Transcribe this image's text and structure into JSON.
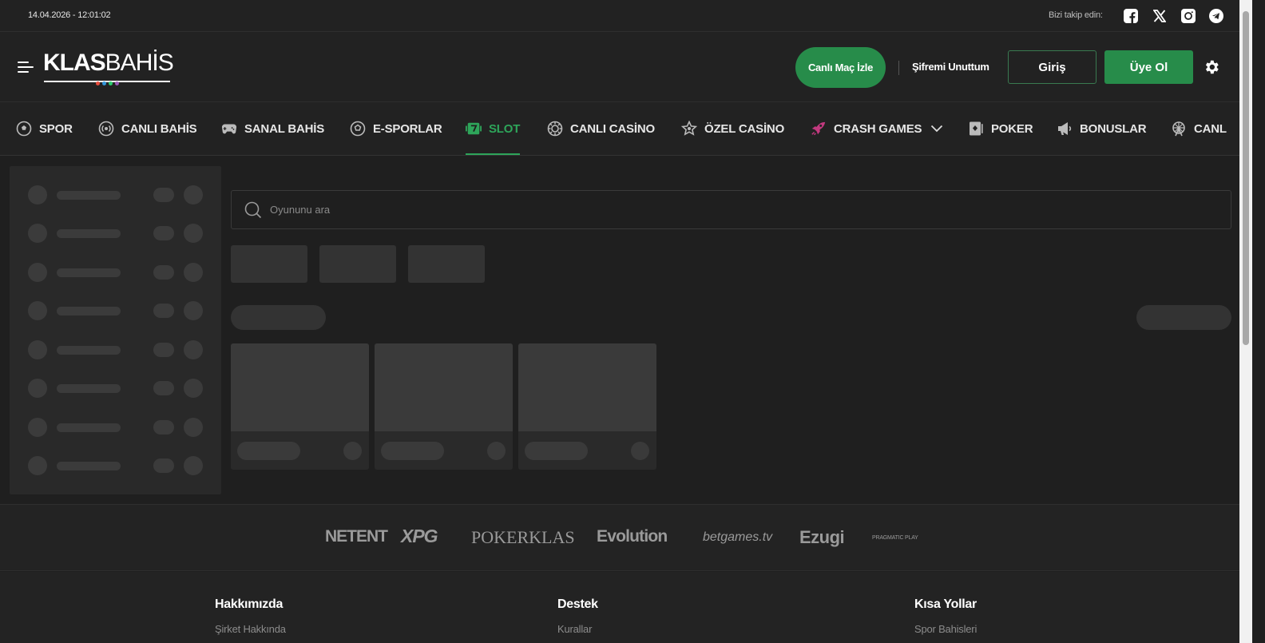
{
  "topbar": {
    "datetime": "14.04.2026 - 12:01:02",
    "follow_label": "Bizi takip edin:",
    "social": [
      "facebook-icon",
      "x-icon",
      "instagram-icon",
      "telegram-icon"
    ]
  },
  "header": {
    "logo": {
      "bold": "KLAS",
      "light": "BAHİS",
      "dot_colors": [
        "#e74c3c",
        "#3498db",
        "#2ecc71",
        "#9b59b6"
      ]
    },
    "live_button": "Canlı Maç İzle",
    "forgot_password": "Şifremi Unuttum",
    "login": "Giriş",
    "register": "Üye Ol"
  },
  "nav": {
    "items": [
      {
        "label": "SPOR",
        "icon": "soccer-ball-icon"
      },
      {
        "label": "CANLI BAHİS",
        "icon": "live-broadcast-icon"
      },
      {
        "label": "SANAL BAHİS",
        "icon": "gamepad-icon"
      },
      {
        "label": "E-SPORLAR",
        "icon": "esports-icon"
      },
      {
        "label": "SLOT",
        "icon": "slot-seven-icon",
        "active": true
      },
      {
        "label": "CANLI CASİNO",
        "icon": "casino-chip-icon"
      },
      {
        "label": "ÖZEL CASİNO",
        "icon": "star-icon"
      },
      {
        "label": "CRASH GAMES",
        "icon": "rocket-icon"
      },
      {
        "label": "POKER",
        "icon": "playing-card-icon"
      },
      {
        "label": "BONUSLAR",
        "icon": "megaphone-icon"
      },
      {
        "label": "CANL",
        "icon": "ferris-wheel-icon"
      }
    ],
    "accent": "#2ea55a"
  },
  "search": {
    "placeholder": "Oyununu ara"
  },
  "providers": [
    "NETENT",
    "XPG",
    "POKERKLAS",
    "Evolution",
    "betgames.tv",
    "Ezugi",
    "PRAGMATIC PLAY"
  ],
  "footer": {
    "about": {
      "title": "Hakkımızda",
      "link": "Şirket Hakkında"
    },
    "support": {
      "title": "Destek",
      "link": "Kurallar"
    },
    "shortcuts": {
      "title": "Kısa Yollar",
      "link": "Spor Bahisleri"
    }
  },
  "colors": {
    "primary_green": "#278c4a",
    "background": "#1f1f1f"
  }
}
